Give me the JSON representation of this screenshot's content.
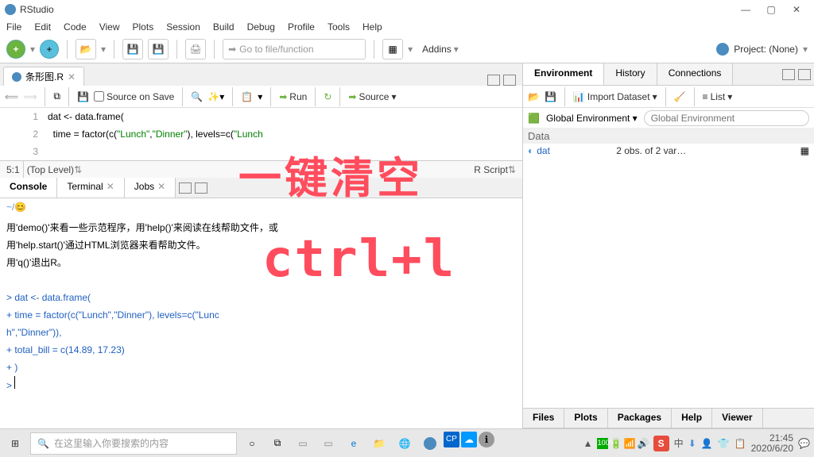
{
  "window": {
    "title": "RStudio"
  },
  "winbtns": {
    "min": "—",
    "max": "▢",
    "close": "✕"
  },
  "menu": [
    "File",
    "Edit",
    "Code",
    "View",
    "Plots",
    "Session",
    "Build",
    "Debug",
    "Profile",
    "Tools",
    "Help"
  ],
  "toolbar": {
    "gotofile": "Go to file/function",
    "addins": "Addins",
    "project": "Project: (None)"
  },
  "source": {
    "tab": "条形图.R",
    "source_on_save": "Source on Save",
    "run": "Run",
    "source_btn": "Source",
    "lines": [
      "1",
      "2",
      "3"
    ],
    "code1_a": "dat <- data.frame(",
    "code2_a": "  time = factor(c(",
    "code2_b": "\"Lunch\"",
    "code2_c": ",",
    "code2_d": "\"Dinner\"",
    "code2_e": "), levels=c(",
    "code2_f": "\"Lunch",
    "status_pos": "5:1",
    "status_scope": "(Top Level)",
    "status_type": "R Script"
  },
  "console": {
    "tabs": [
      "Console",
      "Terminal",
      "Jobs"
    ],
    "path": "~/",
    "help1": "用'demo()'来看一些示范程序，用'help()'来阅读在线帮助文件，或",
    "help2": "用'help.start()'通过HTML浏览器来看帮助文件。",
    "help3": "用'q()'退出R。",
    "l1": "> dat <- data.frame(",
    "l2": "+   time = factor(c(\"Lunch\",\"Dinner\"), levels=c(\"Lunc",
    "l3": "h\",\"Dinner\")),",
    "l4": "+   total_bill = c(14.89, 17.23)",
    "l5": "+ )",
    "l6": "> "
  },
  "env": {
    "tabs": [
      "Environment",
      "History",
      "Connections"
    ],
    "import": "Import Dataset",
    "list": "List",
    "scope": "Global Environment",
    "section": "Data",
    "var_name": "dat",
    "var_val": "2 obs. of 2 var…"
  },
  "files_tabs": [
    "Files",
    "Plots",
    "Packages",
    "Help",
    "Viewer"
  ],
  "annotation": {
    "line1": "一键清空",
    "line2": "ctrl+l"
  },
  "taskbar": {
    "search": "在这里输入你要搜索的内容",
    "time": "21:45",
    "date": "2020/6/20",
    "ime": "中"
  }
}
